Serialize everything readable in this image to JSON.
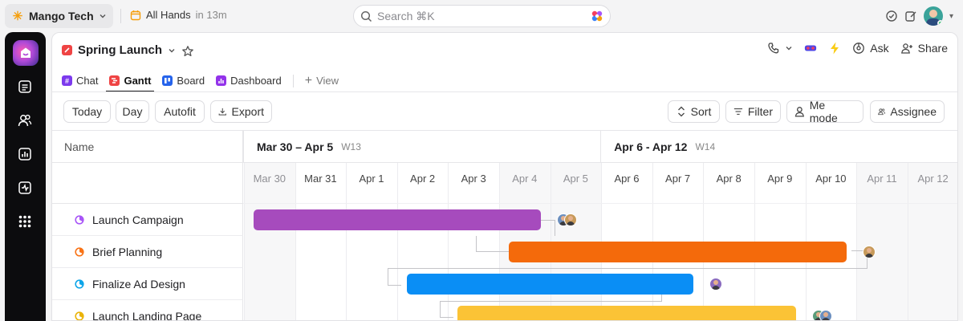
{
  "topbar": {
    "workspace_name": "Mango Tech",
    "meeting_title": "All Hands",
    "meeting_time": "in 13m",
    "search_placeholder": "Search ⌘K"
  },
  "project": {
    "title": "Spring Launch",
    "header_actions": {
      "ask": "Ask",
      "share": "Share"
    }
  },
  "tabs": [
    {
      "label": "Chat",
      "color": "#7c3aed"
    },
    {
      "label": "Gantt",
      "color": "#ef4444",
      "active": true
    },
    {
      "label": "Board",
      "color": "#2563eb"
    },
    {
      "label": "Dashboard",
      "color": "#9333ea"
    }
  ],
  "add_view_label": "View",
  "toolbar": {
    "today": "Today",
    "day": "Day",
    "autofit": "Autofit",
    "export": "Export",
    "sort": "Sort",
    "filter": "Filter",
    "me_mode": "Me mode",
    "assignee": "Assignee"
  },
  "gantt": {
    "name_header": "Name",
    "weeks": [
      {
        "range": "Mar 30 – Apr 5",
        "week": "W13"
      },
      {
        "range": "Apr 6 - Apr 12",
        "week": "W14"
      }
    ],
    "days": [
      {
        "label": "Mar 30",
        "weekend": true
      },
      {
        "label": "Mar 31",
        "weekend": false
      },
      {
        "label": "Apr 1",
        "weekend": false
      },
      {
        "label": "Apr 2",
        "weekend": false
      },
      {
        "label": "Apr 3",
        "weekend": false
      },
      {
        "label": "Apr 4",
        "weekend": true
      },
      {
        "label": "Apr 5",
        "weekend": true
      },
      {
        "label": "Apr 6",
        "weekend": false
      },
      {
        "label": "Apr 7",
        "weekend": false
      },
      {
        "label": "Apr 8",
        "weekend": false
      },
      {
        "label": "Apr 9",
        "weekend": false
      },
      {
        "label": "Apr 10",
        "weekend": false
      },
      {
        "label": "Apr 11",
        "weekend": true
      },
      {
        "label": "Apr 12",
        "weekend": true
      }
    ],
    "tasks": [
      {
        "name": "Launch Campaign",
        "status_color": "#a855f7",
        "bar_color": "#a64bbd",
        "start": "Mar 30",
        "end": "Apr 4",
        "assignees": 2
      },
      {
        "name": "Brief Planning",
        "status_color": "#f97316",
        "bar_color": "#f46a0b",
        "start": "Apr 4",
        "end": "Apr 10",
        "assignees": 1
      },
      {
        "name": "Finalize Ad Design",
        "status_color": "#0ea5e9",
        "bar_color": "#0a8ef5",
        "start": "Apr 2",
        "end": "Apr 7",
        "assignees": 1
      },
      {
        "name": "Launch Landing Page",
        "status_color": "#eab308",
        "bar_color": "#fbc336",
        "start": "Apr 3",
        "end": "Apr 9",
        "assignees": 2
      }
    ]
  }
}
